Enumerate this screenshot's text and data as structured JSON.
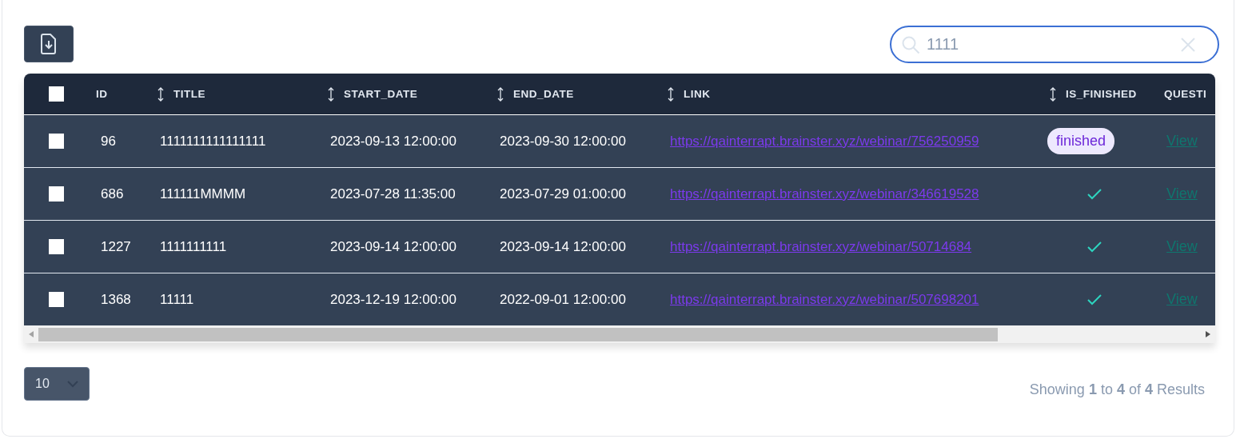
{
  "toolbar": {
    "export_button": {
      "kind": "icon"
    }
  },
  "search": {
    "value": "1111"
  },
  "table": {
    "select_all": {
      "checked": false
    },
    "columns": [
      {
        "label": "ID",
        "sortable": false
      },
      {
        "label": "TITLE",
        "sortable": true
      },
      {
        "label": "START_DATE",
        "sortable": true
      },
      {
        "label": "END_DATE",
        "sortable": true
      },
      {
        "label": "LINK",
        "sortable": true
      },
      {
        "label": "IS_FINISHED",
        "sortable": true
      },
      {
        "label": "QUESTI",
        "sortable": false
      }
    ],
    "rows": [
      {
        "checked": false,
        "id": "96",
        "title": "1111111111111111",
        "start_date": "2023-09-13 12:00:00",
        "end_date": "2023-09-30 12:00:00",
        "link": "https://qainterrapt.brainster.xyz/webinar/756250959",
        "is_finished": {
          "kind": "badge",
          "text": "finished"
        },
        "questions": "View"
      },
      {
        "checked": false,
        "id": "686",
        "title": "111111MMMM",
        "start_date": "2023-07-28 11:35:00",
        "end_date": "2023-07-29 01:00:00",
        "link": "https://qainterrapt.brainster.xyz/webinar/346619528",
        "is_finished": {
          "kind": "check"
        },
        "questions": "View"
      },
      {
        "checked": false,
        "id": "1227",
        "title": "1111111111",
        "start_date": "2023-09-14 12:00:00",
        "end_date": "2023-09-14 12:00:00",
        "link": "https://qainterrapt.brainster.xyz/webinar/50714684",
        "is_finished": {
          "kind": "check"
        },
        "questions": "View"
      },
      {
        "checked": false,
        "id": "1368",
        "title": "11111",
        "start_date": "2023-12-19 12:00:00",
        "end_date": "2022-09-01 12:00:00",
        "link": "https://qainterrapt.brainster.xyz/webinar/507698201",
        "is_finished": {
          "kind": "check"
        },
        "questions": "View"
      }
    ]
  },
  "footer": {
    "per_page": "10",
    "summary": "Showing **1** to **4** of **4** Results"
  }
}
